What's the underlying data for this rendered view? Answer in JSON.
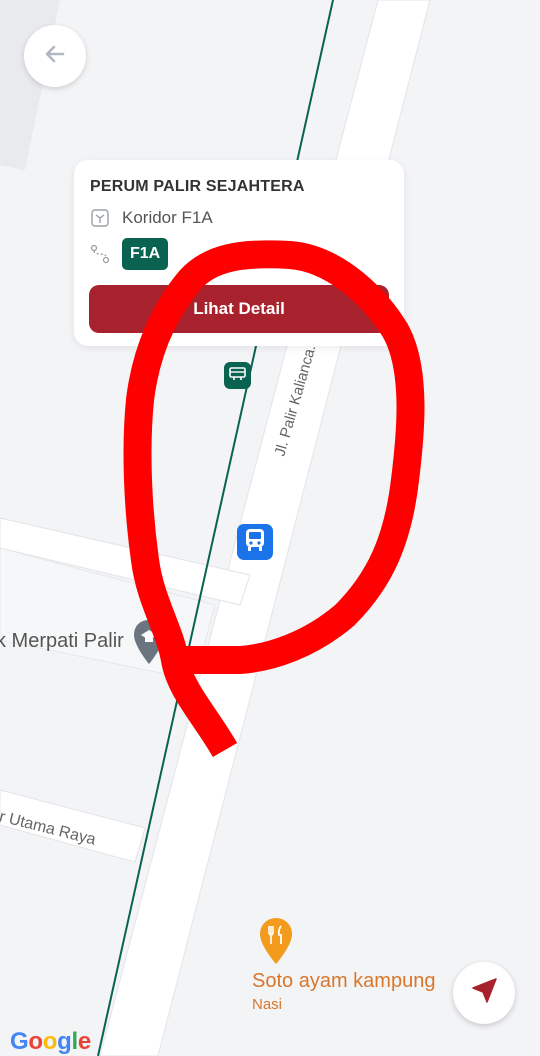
{
  "map": {
    "streets": {
      "pair_kalianca": "Jl. Palir Kalianca.",
      "utama_raya": "r Utama Raya"
    },
    "poi_school": "k Merpati Palir",
    "poi_food": {
      "title": "Soto ayam kampung",
      "subtitle": "Nasi",
      "icon": "restaurant-pin-icon",
      "color": "#d9762b"
    },
    "attribution": "Google"
  },
  "card": {
    "stop_name": "PERUM PALIR SEJAHTERA",
    "corridor_label": "Koridor F1A",
    "route_badge": "F1A",
    "detail_button": "Lihat Detail",
    "badge_color": "#0a6350",
    "button_color": "#a8222e"
  },
  "icons": {
    "back": "arrow-left-icon",
    "locate": "navigation-arrow-icon",
    "halte": "bus-stop-icon",
    "bus": "bus-icon"
  },
  "annotation": {
    "color": "#ff0000",
    "shape": "red hand-drawn loop"
  }
}
